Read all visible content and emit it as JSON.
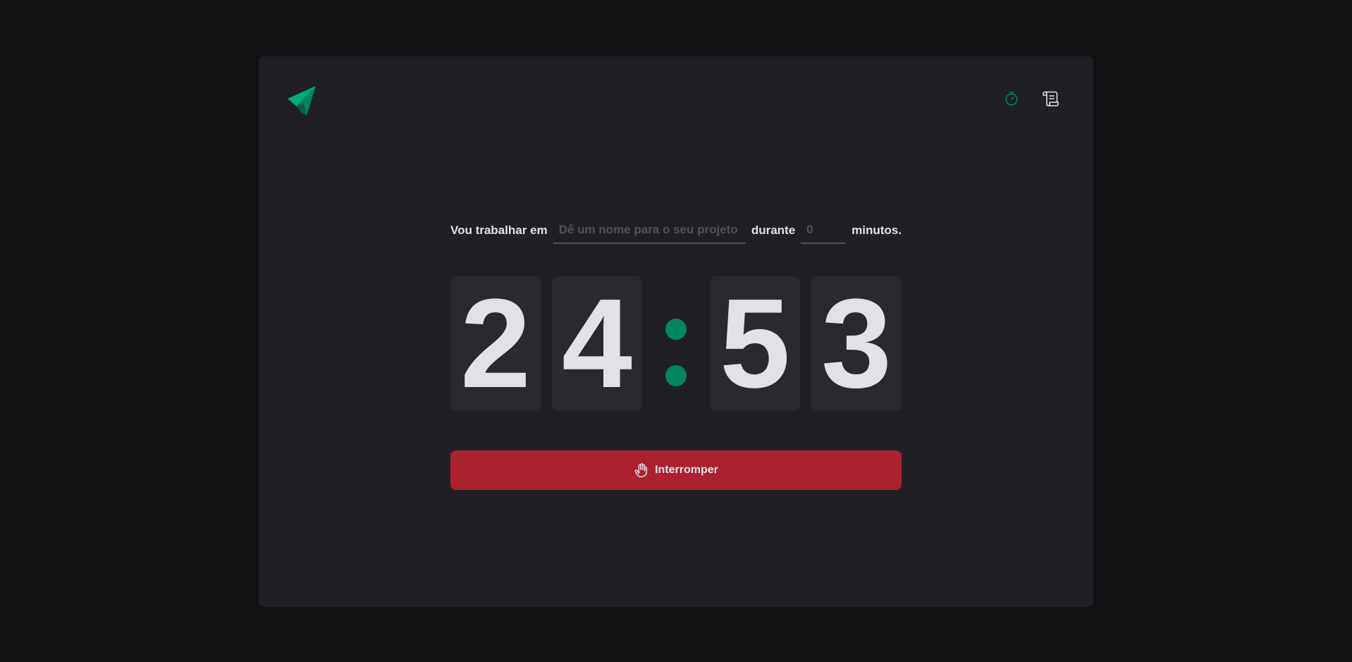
{
  "header": {
    "logo_icon": "paper-plane-logo",
    "nav": [
      {
        "icon": "timer-icon",
        "color": "#00875f"
      },
      {
        "icon": "scroll-icon",
        "color": "#e1e1e6"
      }
    ]
  },
  "form": {
    "label_task": "Vou trabalhar em",
    "task_placeholder": "Dê um nome para o seu projeto",
    "task_value": "",
    "label_during": "durante",
    "minutes_placeholder": "0",
    "minutes_value": "",
    "label_minutes": "minutos."
  },
  "countdown": {
    "minutes_tens": "2",
    "minutes_ones": "4",
    "seconds_tens": "5",
    "seconds_ones": "3",
    "separator_color": "#00875f"
  },
  "action": {
    "label": "Interromper",
    "icon": "hand-palm-icon",
    "color": "#ab222e"
  },
  "colors": {
    "background": "#121214",
    "card": "#202024",
    "digit_bg": "#29292e",
    "accent": "#00875f",
    "text": "#e1e1e6"
  }
}
